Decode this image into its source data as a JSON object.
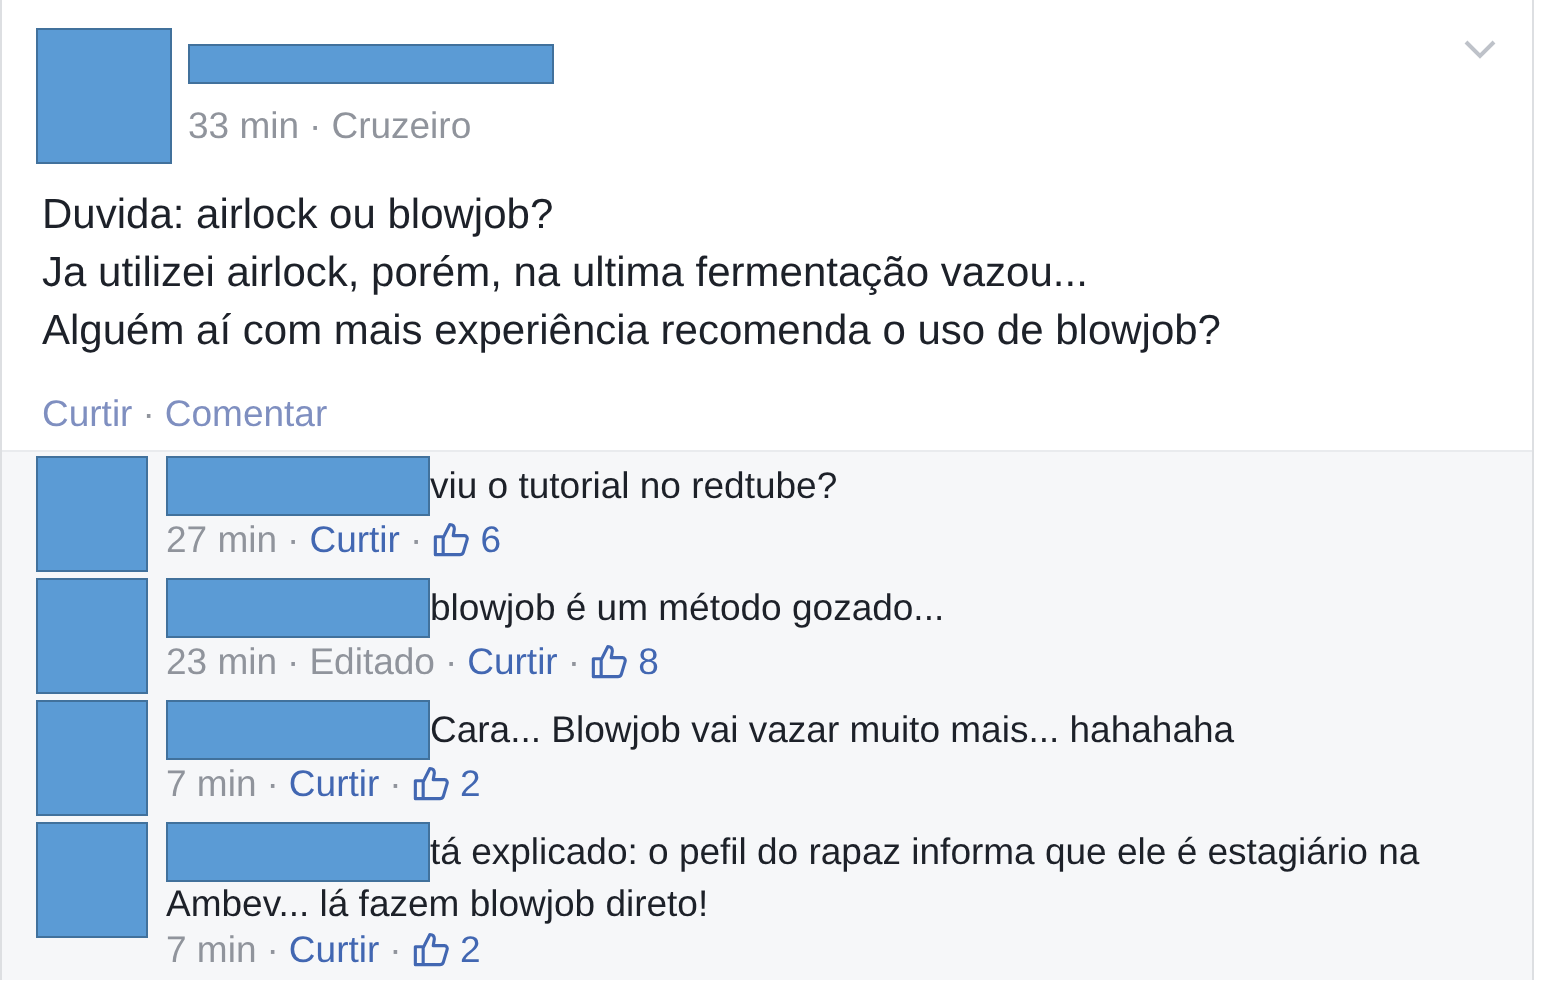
{
  "separator": "·",
  "post": {
    "time": "33 min",
    "location": "Cruzeiro",
    "lines": [
      "Duvida: airlock ou blowjob?",
      "Ja utilizei airlock, porém, na ultima fermentação vazou...",
      "Alguém aí com mais experiência recomenda o uso de blowjob?"
    ],
    "actions": [
      "Curtir",
      "Comentar"
    ]
  },
  "comments": [
    {
      "lines": [
        "viu o tutorial no redtube?"
      ],
      "time": "27 min",
      "like": "Curtir",
      "likes": "6"
    },
    {
      "lines": [
        "blowjob é um método gozado..."
      ],
      "time": "23 min",
      "edited": "Editado",
      "like": "Curtir",
      "likes": "8"
    },
    {
      "lines": [
        "Cara... Blowjob vai vazar muito mais... hahahaha"
      ],
      "time": "7 min",
      "like": "Curtir",
      "likes": "2"
    },
    {
      "lines": [
        "tá explicado: o pefil do rapaz informa que ele é estagiário na",
        "Ambev... lá fazem blowjob direto!"
      ],
      "time": "7 min",
      "like": "Curtir",
      "likes": "2"
    }
  ]
}
